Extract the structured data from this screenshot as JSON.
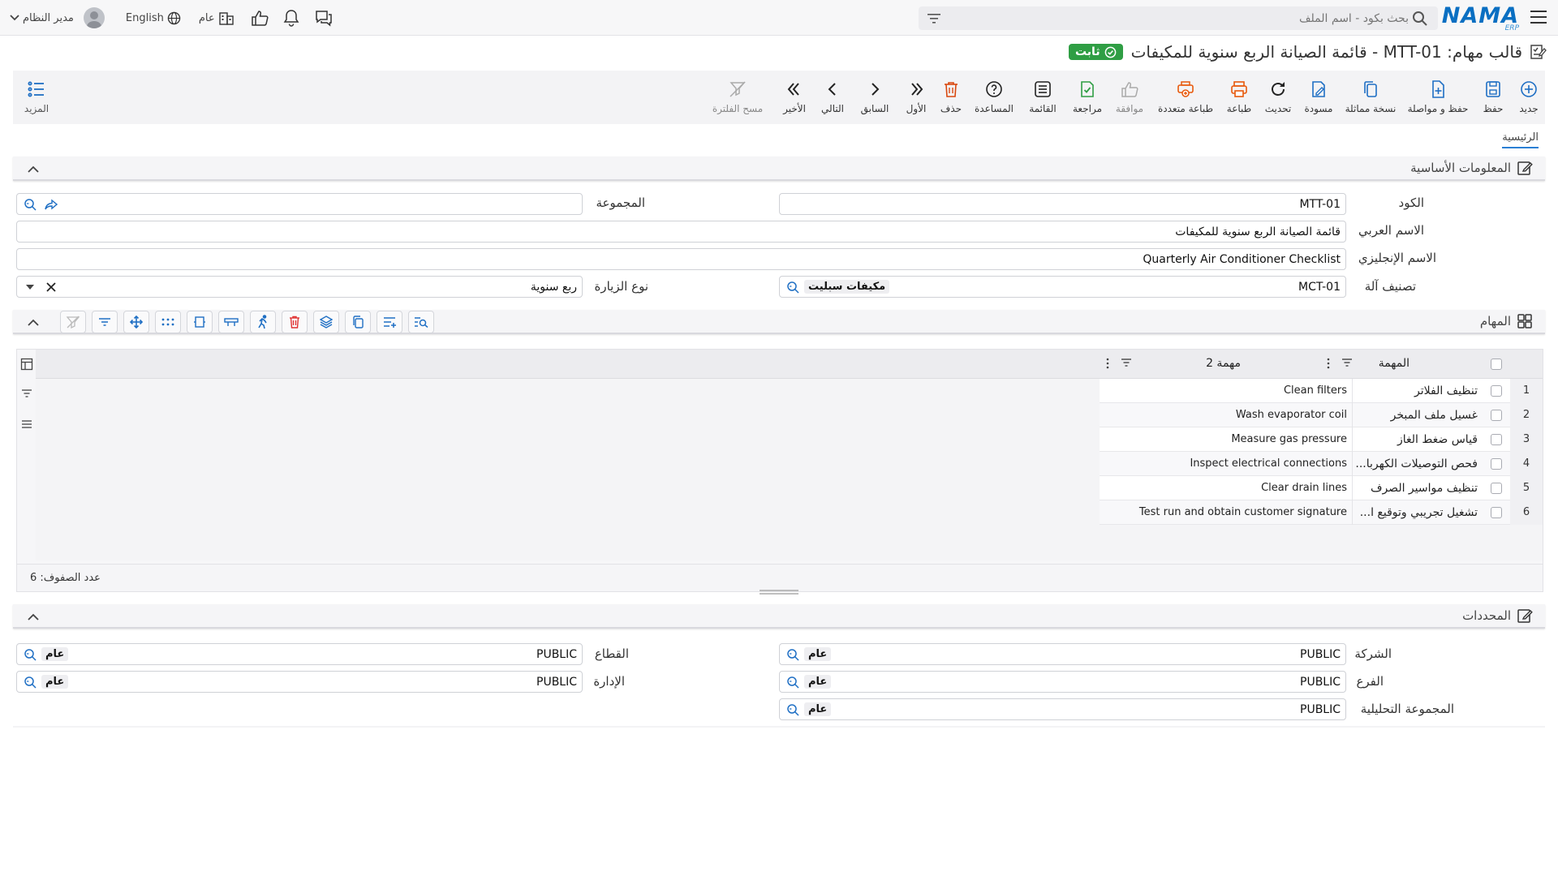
{
  "topbar": {
    "logo": "NAMA",
    "logo_sub": "ERP",
    "search_placeholder": "بحث بكود - اسم الملف",
    "public_label": "عام",
    "language": "English",
    "user": "مدير النظام"
  },
  "title": {
    "text": "قالب مهام: MTT-01 - قائمة الصيانة الربع سنوية للمكيفات",
    "badge": "ثابت"
  },
  "actions": [
    {
      "label": "جديد",
      "icon": "plus-circle-icon",
      "color": "#1f6fc4"
    },
    {
      "label": "حفظ",
      "icon": "save-icon",
      "color": "#1f6fc4"
    },
    {
      "label": "حفظ و مواصلة",
      "icon": "save-continue-icon",
      "color": "#1f6fc4"
    },
    {
      "label": "نسخة مماثلة",
      "icon": "copy-icon",
      "color": "#1f6fc4"
    },
    {
      "label": "مسودة",
      "icon": "draft-icon",
      "color": "#1f6fc4"
    },
    {
      "label": "تحديث",
      "icon": "refresh-icon",
      "color": "#222222"
    },
    {
      "label": "طباعة",
      "icon": "print-icon",
      "color": "#e8590c"
    },
    {
      "label": "طباعة متعددة",
      "icon": "multi-print-icon",
      "color": "#e8590c"
    },
    {
      "label": "موافقة",
      "icon": "approve-icon",
      "color": "#aaaaaa"
    },
    {
      "label": "مراجعة",
      "icon": "review-icon",
      "color": "#2f9e44"
    },
    {
      "label": "القائمة",
      "icon": "list-icon",
      "color": "#222222"
    },
    {
      "label": "المساعدة",
      "icon": "help-icon",
      "color": "#222222"
    },
    {
      "label": "حذف",
      "icon": "trash-icon",
      "color": "#d9480f"
    },
    {
      "label": "الأول",
      "icon": "first-icon",
      "color": "#222222"
    },
    {
      "label": "السابق",
      "icon": "prev-icon",
      "color": "#222222"
    },
    {
      "label": "التالي",
      "icon": "next-icon",
      "color": "#222222"
    },
    {
      "label": "الأخير",
      "icon": "last-icon",
      "color": "#222222"
    },
    {
      "label": "مسح الفلترة",
      "icon": "clear-filter-icon",
      "color": "#aaaaaa"
    }
  ],
  "more_label": "المزيد",
  "tab_label": "الرئيسية",
  "sections": {
    "basic": "المعلومات الأساسية",
    "tasks": "المهام",
    "dimensions": "المحددات"
  },
  "form": {
    "code_label": "الكود",
    "code_value": "MTT-01",
    "group_label": "المجموعة",
    "group_value": "",
    "arabic_name_label": "الاسم العربي",
    "arabic_name_value": "قائمة الصيانة الربع سنوية للمكيفات",
    "english_name_label": "الاسم الإنجليزي",
    "english_name_value": "Quarterly Air Conditioner Checklist",
    "machine_class_label": "تصنيف آلة",
    "machine_class_code": "MCT-01",
    "machine_class_name": "مكيفات سبليت",
    "visit_type_label": "نوع الزيارة",
    "visit_type_value": "ربع سنوية"
  },
  "grid": {
    "col_task": "المهمة",
    "col_task2": "مهمة 2",
    "rows": [
      {
        "num": "1",
        "ar": "تنظيف الفلاتر",
        "en": "Clean filters"
      },
      {
        "num": "2",
        "ar": "غسيل ملف المبخر",
        "en": "Wash evaporator coil"
      },
      {
        "num": "3",
        "ar": "قياس ضغط الغاز",
        "en": "Measure gas pressure"
      },
      {
        "num": "4",
        "ar": "فحص التوصيلات الكهربا...",
        "en": "Inspect electrical connections"
      },
      {
        "num": "5",
        "ar": "تنظيف مواسير الصرف",
        "en": "Clear drain lines"
      },
      {
        "num": "6",
        "ar": "تشغيل تجريبي وتوقيع ا...",
        "en": "Test run and obtain customer signature"
      }
    ],
    "row_count": "عدد الصفوف: 6"
  },
  "dimensions": {
    "company_label": "الشركة",
    "company_code": "PUBLIC",
    "company_name": "عام",
    "sector_label": "القطاع",
    "sector_code": "PUBLIC",
    "sector_name": "عام",
    "branch_label": "الفرع",
    "branch_code": "PUBLIC",
    "branch_name": "عام",
    "department_label": "الإدارة",
    "department_code": "PUBLIC",
    "department_name": "عام",
    "analytic_label": "المجموعة التحليلية",
    "analytic_code": "PUBLIC",
    "analytic_name": "عام"
  }
}
